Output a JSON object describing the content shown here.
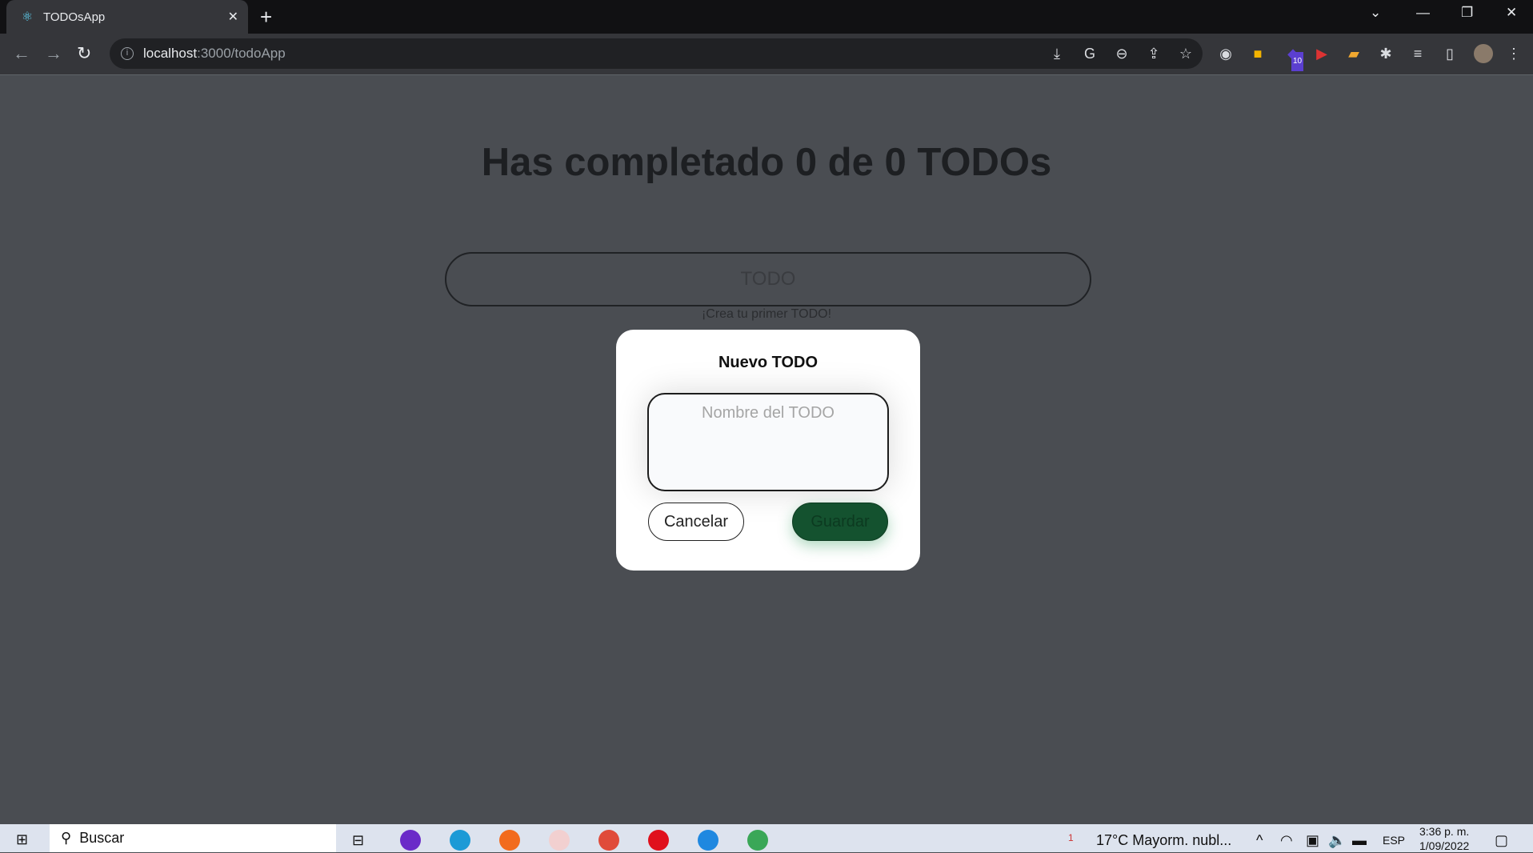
{
  "browser": {
    "tab_title": "TODOsApp",
    "url_host": "localhost",
    "url_path": ":3000/todoApp",
    "extension_badge": "10"
  },
  "page": {
    "title": "Has completado 0 de 0 TODOs",
    "search_placeholder": "TODO",
    "empty_hint": "¡Crea tu primer TODO!"
  },
  "modal": {
    "title": "Nuevo TODO",
    "textarea_placeholder": "Nombre del TODO",
    "cancel_label": "Cancelar",
    "save_label": "Guardar"
  },
  "taskbar": {
    "search_label": "Buscar",
    "weather": "17°C  Mayorm. nubl...",
    "weather_badge": "1",
    "language": "ESP",
    "time": "3:36 p. m.",
    "date": "1/09/2022"
  },
  "colors": {
    "overlay_bg": "#4a4d52",
    "save_button": "#14522f",
    "modal_bg": "#ffffff"
  }
}
